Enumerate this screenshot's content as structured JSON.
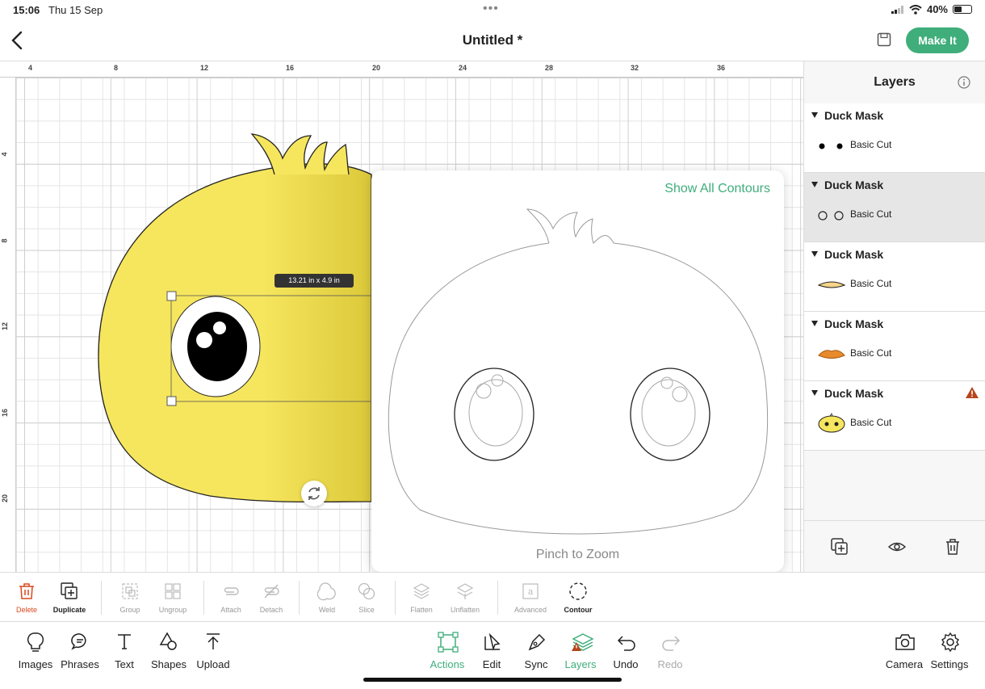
{
  "status": {
    "time": "15:06",
    "date": "Thu 15 Sep",
    "battery": "40%"
  },
  "header": {
    "title": "Untitled *",
    "make_it_label": "Make It"
  },
  "rulers": {
    "top": [
      "4",
      "8",
      "12",
      "16",
      "20",
      "24",
      "28",
      "32",
      "36"
    ],
    "left": [
      "4",
      "8",
      "12",
      "16",
      "20"
    ]
  },
  "canvas": {
    "dimension_label": "13.21 in x 4.9 in",
    "fill_color": "#f5e35c"
  },
  "contour": {
    "show_all_label": "Show All Contours",
    "hint": "Pinch to Zoom"
  },
  "layers": {
    "title": "Layers",
    "groups": [
      {
        "name": "Duck Mask",
        "layer": "Basic Cut",
        "thumb": "black-dots",
        "selected": false,
        "warning": false
      },
      {
        "name": "Duck Mask",
        "layer": "Basic Cut",
        "thumb": "outline-circles",
        "selected": true,
        "warning": false
      },
      {
        "name": "Duck Mask",
        "layer": "Basic Cut",
        "thumb": "beak-outline",
        "selected": false,
        "warning": false
      },
      {
        "name": "Duck Mask",
        "layer": "Basic Cut",
        "thumb": "beak-orange",
        "selected": false,
        "warning": false
      },
      {
        "name": "Duck Mask",
        "layer": "Basic Cut",
        "thumb": "duck-face",
        "selected": false,
        "warning": true
      }
    ]
  },
  "actions": {
    "delete": "Delete",
    "duplicate": "Duplicate",
    "group": "Group",
    "ungroup": "Ungroup",
    "attach": "Attach",
    "detach": "Detach",
    "weld": "Weld",
    "slice": "Slice",
    "flatten": "Flatten",
    "unflatten": "Unflatten",
    "advanced": "Advanced",
    "contour": "Contour"
  },
  "bottom": {
    "images": "Images",
    "phrases": "Phrases",
    "text": "Text",
    "shapes": "Shapes",
    "upload": "Upload",
    "actions": "Actions",
    "edit": "Edit",
    "sync": "Sync",
    "layers": "Layers",
    "undo": "Undo",
    "redo": "Redo",
    "camera": "Camera",
    "settings": "Settings"
  },
  "colors": {
    "accent": "#3fae7b",
    "danger": "#d9481e",
    "warning": "#b5451b"
  }
}
